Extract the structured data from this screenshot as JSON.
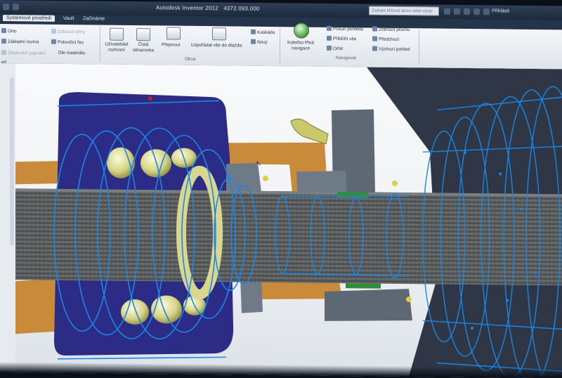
{
  "window": {
    "app_title": "Autodesk Inventor 2012",
    "file_name": "4372.093.000"
  },
  "search": {
    "placeholder": "Zadejte klíčové slovo nebo výraz"
  },
  "account": {
    "sign_in": "Přihlásit"
  },
  "tabs": [
    {
      "label": "Systémové prostředí",
      "active": true
    },
    {
      "label": "Vault",
      "active": false
    },
    {
      "label": "Začínáme",
      "active": false
    }
  ],
  "ribbon": {
    "left_fragments": {
      "orto": "Orto",
      "zakladni_rovina": "Základní rovina",
      "sledovani_paprsku": "Sledování paprsků"
    },
    "appearance": {
      "zobrazit_stiny": "Zobrazit stíny",
      "polovicni_rez": "Poloviční řez",
      "dle_materialu": "Dle materiálu"
    },
    "windows": {
      "user_interface": "Uživatelské rozhraní",
      "clean_screen": "Čistá obrazovka",
      "switch": "Přepnout",
      "arrange_all": "Uspořádat vše do dlaždic",
      "cascade": "Kaskáda",
      "new": "Nový",
      "group_label": "Okna"
    },
    "navigation": {
      "wheel": "Kolečko Plná navigace",
      "pan": "Posun pohledu",
      "zoom_all": "Přiblížit vše",
      "orbit": "Orbit",
      "look_at": "Zobrazit plochu",
      "previous": "Předchozí",
      "home_view": "Výchozí pohled",
      "group_label": "Navigovat"
    }
  },
  "left_panel": {
    "label": "ed"
  },
  "colors": {
    "wireframe": "#1a86e6",
    "shaft": "#5b5e5e",
    "housing": "#2c2b86",
    "bronze": "#c98a3a",
    "bearing_roller": "#d6d48a",
    "steel_part": "#6f7a88",
    "green_detail": "#2f8d3c"
  },
  "model": {
    "description": "bearing housing assembly with rotating shaft (3D CAD view)"
  }
}
